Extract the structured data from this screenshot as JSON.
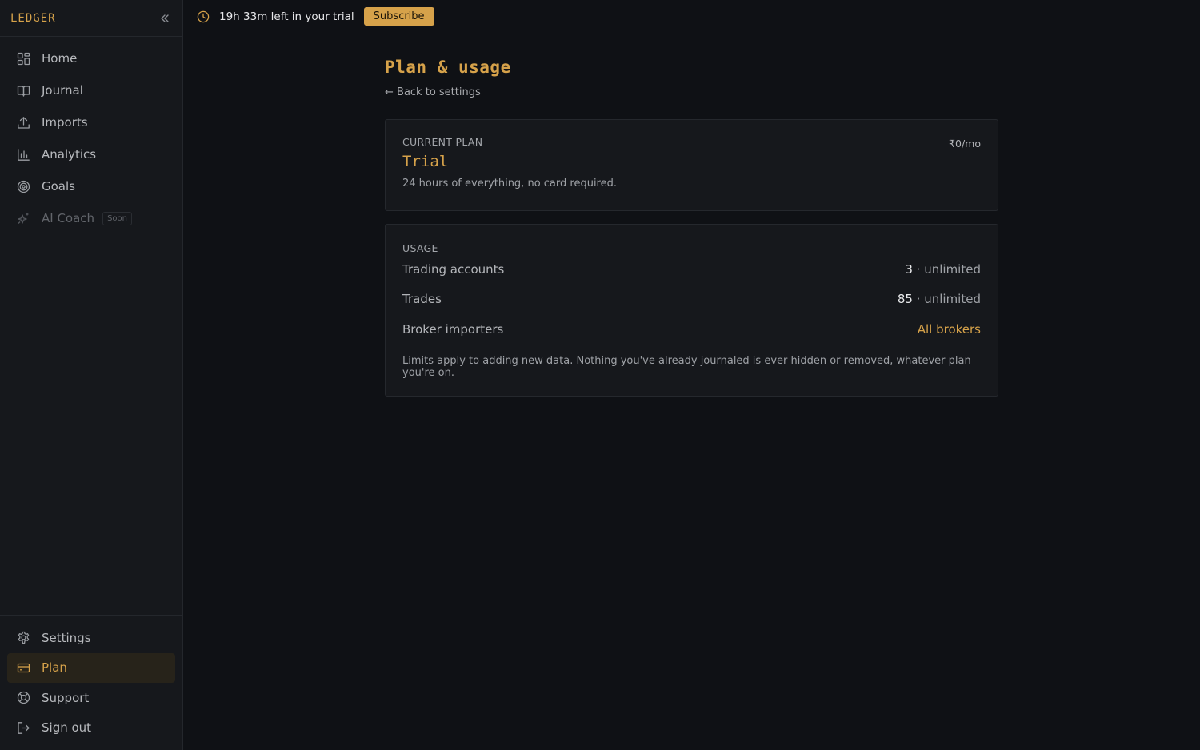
{
  "app": {
    "brand": "LEDGER"
  },
  "sidebar": {
    "items": [
      {
        "label": "Home",
        "icon": "grid-icon"
      },
      {
        "label": "Journal",
        "icon": "book-icon"
      },
      {
        "label": "Imports",
        "icon": "upload-icon"
      },
      {
        "label": "Analytics",
        "icon": "bar-chart-icon"
      },
      {
        "label": "Goals",
        "icon": "target-icon"
      },
      {
        "label": "AI Coach",
        "icon": "sparkle-icon",
        "badge": "Soon",
        "disabled": true
      }
    ],
    "bottom_items": [
      {
        "label": "Settings",
        "icon": "gear-icon"
      },
      {
        "label": "Plan",
        "icon": "credit-card-icon",
        "active": true
      },
      {
        "label": "Support",
        "icon": "lifebuoy-icon"
      },
      {
        "label": "Sign out",
        "icon": "sign-out-icon"
      }
    ]
  },
  "topbar": {
    "trial_text": "19h 33m left in your trial",
    "subscribe_label": "Subscribe"
  },
  "main": {
    "title": "Plan & usage",
    "back_link": "← Back to settings",
    "plan": {
      "label": "CURRENT PLAN",
      "price": "₹0/mo",
      "name": "Trial",
      "description": "24 hours of everything, no card required."
    },
    "usage": {
      "label": "USAGE",
      "rows": [
        {
          "name": "Trading accounts",
          "count": "3",
          "limit": " · unlimited"
        },
        {
          "name": "Trades",
          "count": "85",
          "limit": " · unlimited"
        },
        {
          "name": "Broker importers",
          "value": "All brokers"
        }
      ],
      "note": "Limits apply to adding new data. Nothing you've already journaled is ever hidden or removed, whatever plan you're on."
    }
  },
  "colors": {
    "accent": "#d6a24a",
    "background": "#0f1115",
    "panel": "#16181c"
  }
}
